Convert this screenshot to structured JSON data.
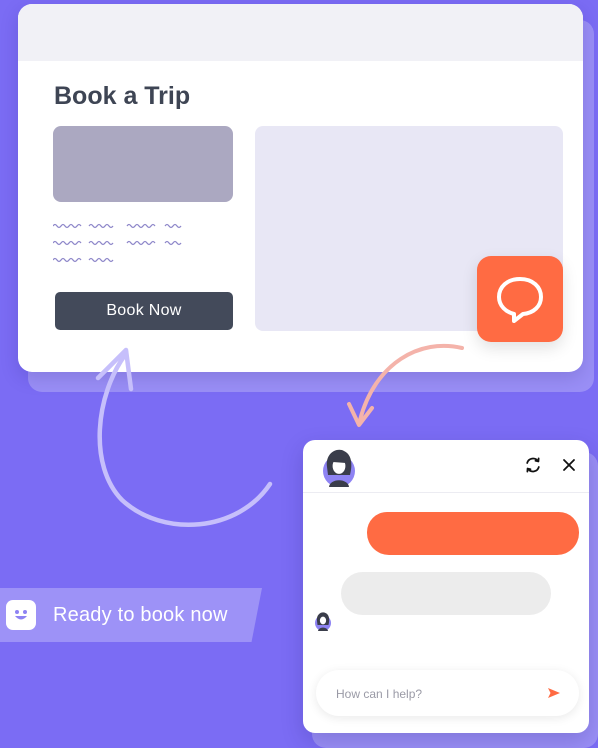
{
  "card": {
    "title": "Book a Trip",
    "book_button_label": "Book Now"
  },
  "banner": {
    "text": "Ready to book now",
    "icon": "smile-face-icon"
  },
  "chat": {
    "input_placeholder": "How can I help?",
    "icons": {
      "launcher": "chat-bubble-icon",
      "refresh": "refresh-icon",
      "close": "close-icon",
      "send": "send-icon",
      "agent": "agent-avatar"
    }
  },
  "colors": {
    "background": "#7b6cf4",
    "accent": "#ff6b43",
    "button": "#434a5a",
    "banner": "#9d92f7"
  }
}
